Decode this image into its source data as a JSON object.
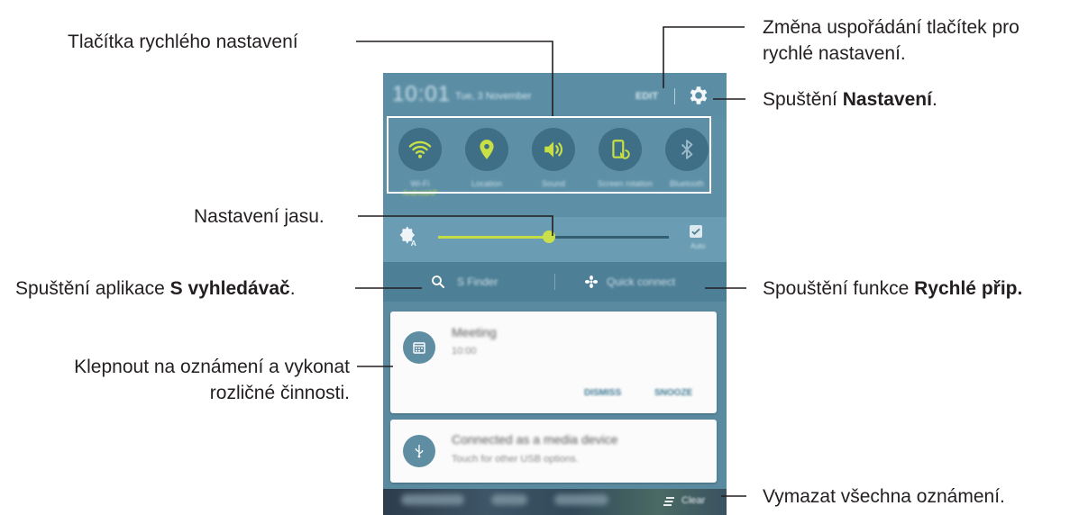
{
  "panel": {
    "status_bar": {
      "time": "10:01",
      "date": "Tue, 3 November",
      "edit_label": "EDIT"
    },
    "quick_settings": [
      {
        "label": "Wi-Fi",
        "sublabel": "AndroidAP",
        "icon": "wifi-icon"
      },
      {
        "label": "Location",
        "sublabel": "",
        "icon": "location-pin-icon"
      },
      {
        "label": "Sound",
        "sublabel": "",
        "icon": "volume-icon"
      },
      {
        "label": "Screen rotation",
        "sublabel": "",
        "icon": "screen-rotation-icon"
      },
      {
        "label": "Bluetooth",
        "sublabel": "",
        "icon": "bluetooth-icon"
      }
    ],
    "brightness": {
      "level": 0.48,
      "auto_label": "Auto",
      "auto_checked": true
    },
    "s_finder_label": "S Finder",
    "quick_connect_label": "Quick connect",
    "notifications": [
      {
        "title": "Meeting",
        "subtitle": "10:00",
        "actions": [
          "DISMISS",
          "SNOOZE"
        ],
        "icon": "calendar-icon"
      },
      {
        "title": "Connected as a media device",
        "subtitle": "Touch for other USB options.",
        "icon": "usb-icon"
      }
    ],
    "clear_label": "Clear"
  },
  "callouts": {
    "quick_settings_buttons": "Tlačítka rychlého nastavení",
    "rearrange_line1": "Změna uspořádání tlačítek pro",
    "rearrange_line2": "rychlé nastavení.",
    "settings_prefix": "Spuštění ",
    "settings_bold": "Nastavení",
    "settings_suffix": ".",
    "brightness": "Nastavení jasu.",
    "sfinder_prefix": "Spuštění aplikace ",
    "sfinder_bold": "S vyhledávač",
    "sfinder_suffix": ".",
    "quickconnect_prefix": "Spouštění funkce ",
    "quickconnect_bold": "Rychlé přip.",
    "notification_line1": "Klepnout na oznámení a vykonat",
    "notification_line2": "rozličné činnosti.",
    "clear_all": "Vymazat všechna oznámení."
  },
  "colors": {
    "panel_blue": "#5a8aa0",
    "accent_green": "#c4dd45",
    "callout_line": "#231f20"
  }
}
